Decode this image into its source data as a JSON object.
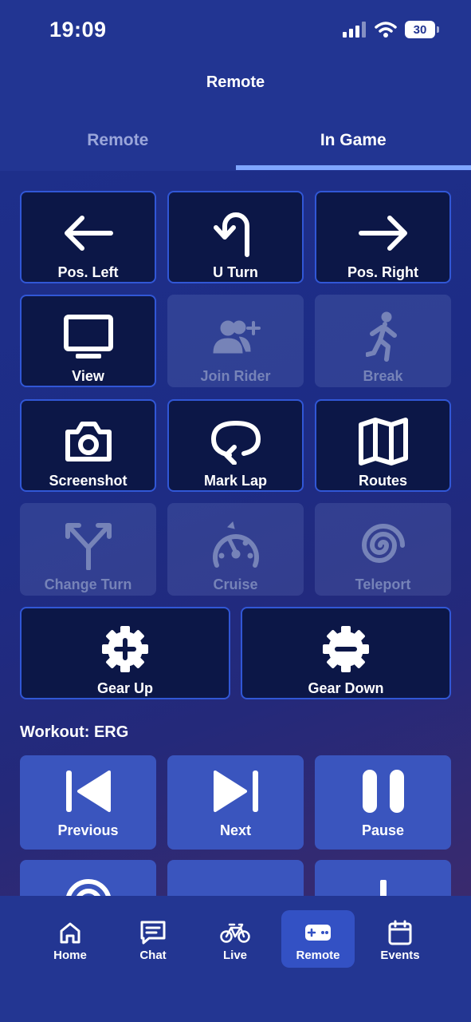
{
  "status_bar": {
    "time": "19:09",
    "battery": "30"
  },
  "header": {
    "title": "Remote"
  },
  "tabs": [
    {
      "label": "Remote",
      "active": false
    },
    {
      "label": "In Game",
      "active": true
    }
  ],
  "in_game_buttons": [
    {
      "label": "Pos. Left",
      "icon": "arrow-left-icon",
      "enabled": true
    },
    {
      "label": "U Turn",
      "icon": "u-turn-icon",
      "enabled": true
    },
    {
      "label": "Pos. Right",
      "icon": "arrow-right-icon",
      "enabled": true
    },
    {
      "label": "View",
      "icon": "monitor-icon",
      "enabled": true
    },
    {
      "label": "Join Rider",
      "icon": "users-plus-icon",
      "enabled": false
    },
    {
      "label": "Break",
      "icon": "walking-person-icon",
      "enabled": false
    },
    {
      "label": "Screenshot",
      "icon": "camera-icon",
      "enabled": true
    },
    {
      "label": "Mark Lap",
      "icon": "loop-arrow-icon",
      "enabled": true
    },
    {
      "label": "Routes",
      "icon": "map-icon",
      "enabled": true
    },
    {
      "label": "Change Turn",
      "icon": "split-arrows-icon",
      "enabled": false
    },
    {
      "label": "Cruise",
      "icon": "speedometer-icon",
      "enabled": false
    },
    {
      "label": "Teleport",
      "icon": "swirl-icon",
      "enabled": false
    }
  ],
  "gear_buttons": [
    {
      "label": "Gear Up",
      "icon": "gear-plus-icon"
    },
    {
      "label": "Gear Down",
      "icon": "gear-minus-icon"
    }
  ],
  "workout": {
    "title": "Workout: ERG",
    "buttons": [
      {
        "label": "Previous",
        "icon": "skip-previous-icon"
      },
      {
        "label": "Next",
        "icon": "skip-next-icon"
      },
      {
        "label": "Pause",
        "icon": "pause-icon"
      }
    ]
  },
  "bottom_nav": [
    {
      "label": "Home",
      "icon": "home-icon",
      "active": false
    },
    {
      "label": "Chat",
      "icon": "chat-icon",
      "active": false
    },
    {
      "label": "Live",
      "icon": "bicycle-icon",
      "active": false
    },
    {
      "label": "Remote",
      "icon": "gamepad-icon",
      "active": true
    },
    {
      "label": "Events",
      "icon": "calendar-icon",
      "active": false
    }
  ],
  "colors": {
    "accent": "#7fa6ff",
    "button_bg": "#0c1747",
    "button_border": "#3157d6",
    "workout_button": "#3a55be"
  }
}
